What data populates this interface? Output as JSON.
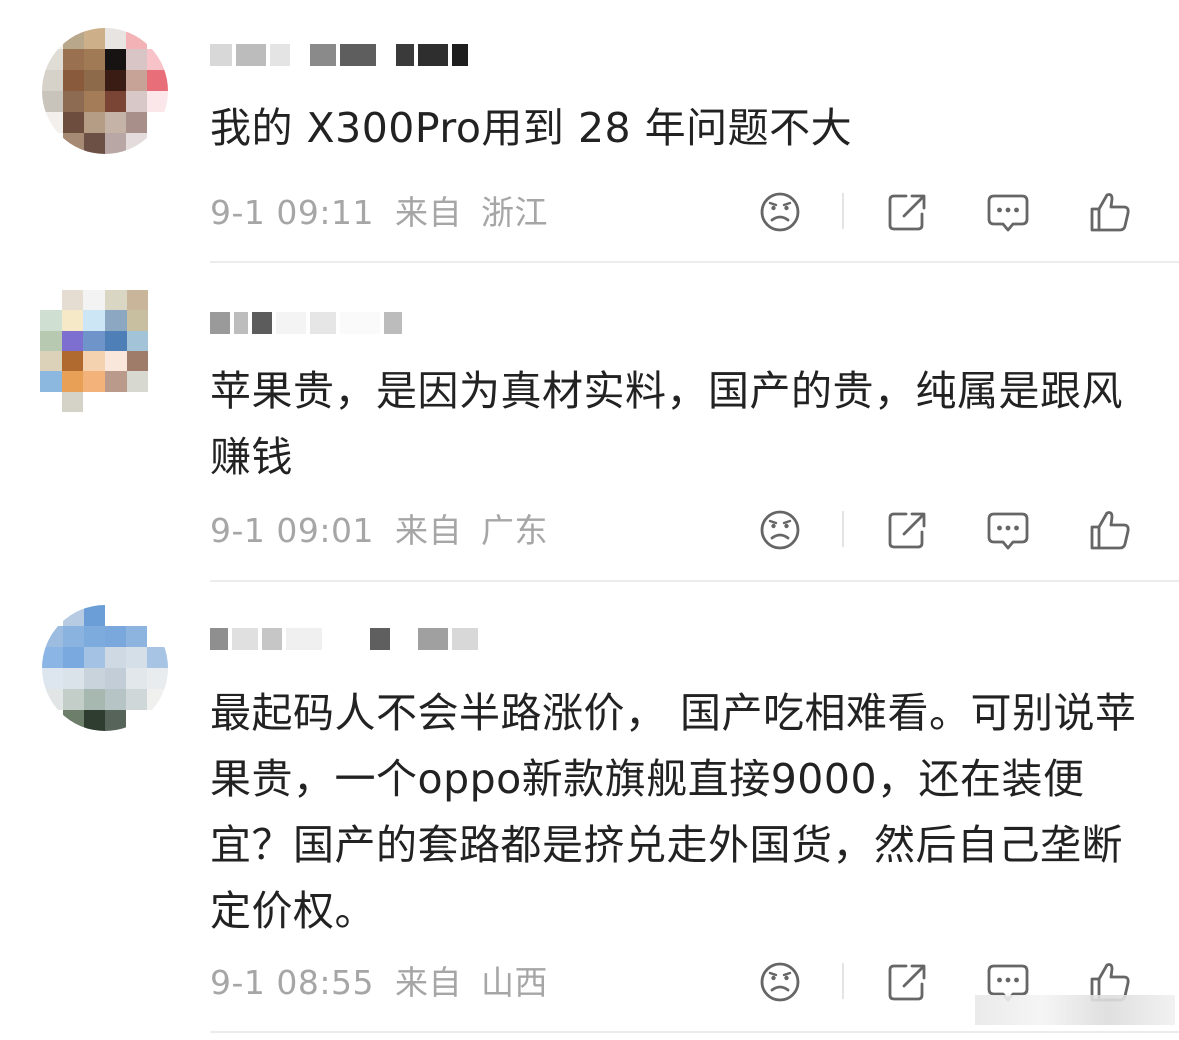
{
  "comments": [
    {
      "text": "我的 X300Pro用到 28 年问题不大",
      "date": "9-1 09:11",
      "from_label": "来自",
      "location": "浙江",
      "avatar_colors": [
        "#f4f1ee",
        "#b9a78c",
        "#cdb08a",
        "#e8e4e2",
        "#f3b3b6",
        "#ffffff",
        "#e0dcd6",
        "#9a7150",
        "#a07a55",
        "#171312",
        "#d9c4c6",
        "#f7c3c9",
        "#d6d1c9",
        "#8a5a3c",
        "#8d6a49",
        "#3a1c14",
        "#c7a297",
        "#e86e7a",
        "#c8c4bc",
        "#8c6b52",
        "#a57c58",
        "#7a4535",
        "#d8c9c8",
        "#fbe7e9",
        "#f2efec",
        "#6d4e3e",
        "#b59c85",
        "#c6b3a8",
        "#a98f8a",
        "#ffffff",
        "#ffffff",
        "#a78a73",
        "#6c4f45",
        "#b8a7a5",
        "#e3dbdc",
        "#ffffff"
      ]
    },
    {
      "text": "苹果贵，是因为真材实料，国产的贵，纯属是跟风赚钱",
      "date": "9-1 09:01",
      "from_label": "来自",
      "location": "广东",
      "avatar_colors": [
        "#ffffff",
        "#e5ddd2",
        "#f2f3f2",
        "#d9d7c4",
        "#c9b59a",
        "#ffffff",
        "#cfe0d2",
        "#f5e9c8",
        "#cde6f5",
        "#8ca7c2",
        "#c7bfa0",
        "#ffffff",
        "#b7c9b0",
        "#7d6fd0",
        "#6f94c9",
        "#4e7fb6",
        "#a3c4d8",
        "#ffffff",
        "#dcd2b9",
        "#b06a2f",
        "#f4d2b0",
        "#f9e7dc",
        "#9e7c69",
        "#ffffff",
        "#8cb8e0",
        "#e7a055",
        "#f3b27a",
        "#ba9a8a",
        "#d7d9d0",
        "#ffffff",
        "#ffffff",
        "#d5d2c8",
        "#ffffff",
        "#ffffff",
        "#ffffff",
        "#ffffff"
      ]
    },
    {
      "text": "最起码人不会半路涨价， 国产吃相难看。可别说苹果贵，一个oppo新款旗舰直接9000，还在装便宜？国产的套路都是挤兑走外国货，然后自己垄断定价权。",
      "date": "9-1 08:55",
      "from_label": "来自",
      "location": "山西",
      "avatar_colors": [
        "#ffffff",
        "#b7cbe2",
        "#6b9ed6",
        "#ffffff",
        "#ffffff",
        "#ffffff",
        "#9dbde0",
        "#8bb3df",
        "#7eabdd",
        "#7ba8dc",
        "#8db4df",
        "#ffffff",
        "#8ab5e4",
        "#7aa9df",
        "#a4c2e4",
        "#cfd9e4",
        "#d5dfe8",
        "#a8c4e5",
        "#dde6ee",
        "#dbe3ea",
        "#c9d3dc",
        "#c2cdd8",
        "#e2e7eb",
        "#e8ecef",
        "#e2e5e6",
        "#c3cec8",
        "#a6b8b0",
        "#b7c4c5",
        "#cfd7d8",
        "#f0f0ef",
        "#ffffff",
        "#6d7e6a",
        "#2f3c30",
        "#56645a",
        "#ffffff",
        "#ffffff"
      ]
    }
  ],
  "icons": {
    "dislike": "sad-face-icon",
    "share": "share-icon",
    "reply": "comment-bubble-icon",
    "like": "thumbs-up-icon"
  },
  "colors": {
    "text": "#222222",
    "meta": "#a6a6a6",
    "icon": "#666666",
    "divider": "#ececec"
  }
}
